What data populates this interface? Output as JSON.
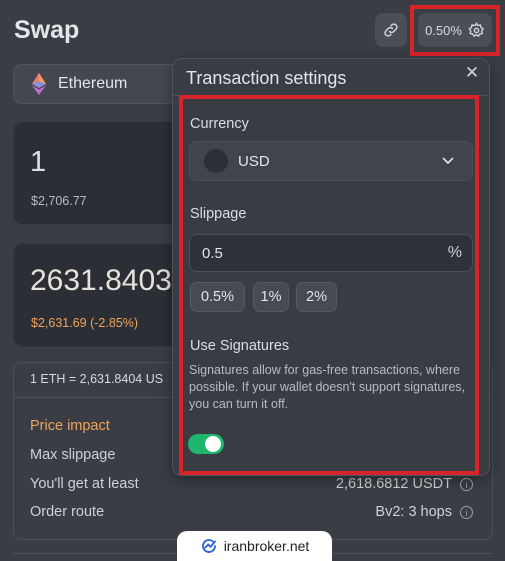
{
  "header": {
    "title": "Swap",
    "slippage_badge": "0.50%"
  },
  "network": {
    "label": "Ethereum"
  },
  "from_card": {
    "amount": "1",
    "usd": "$2,706.77"
  },
  "to_card": {
    "amount": "2631.8403",
    "usd": "$2,631.69 (-2.85%)"
  },
  "details": {
    "rate": "1 ETH = 2,631.8404 US",
    "rows": [
      {
        "label": "Price impact",
        "value": ""
      },
      {
        "label": "Max slippage",
        "value": ""
      },
      {
        "label": "You'll get at least",
        "value": "2,618.6812 USDT"
      },
      {
        "label": "Order route",
        "value": "Bv2: 3 hops"
      }
    ]
  },
  "settings_panel": {
    "title": "Transaction settings",
    "currency_label": "Currency",
    "currency_value": "USD",
    "slippage_label": "Slippage",
    "slippage_value": "0.5",
    "slippage_suffix": "%",
    "presets": [
      "0.5%",
      "1%",
      "2%"
    ],
    "signatures_label": "Use Signatures",
    "signatures_desc": "Signatures allow for gas-free transactions, where possible. If your wallet doesn't support signatures, you can turn it off.",
    "signatures_enabled": true
  },
  "watermark": {
    "text": "iranbroker.net"
  },
  "colors": {
    "accent_orange": "#f0a35a",
    "toggle_on": "#1fb66f",
    "highlight_red": "#d8232a"
  }
}
